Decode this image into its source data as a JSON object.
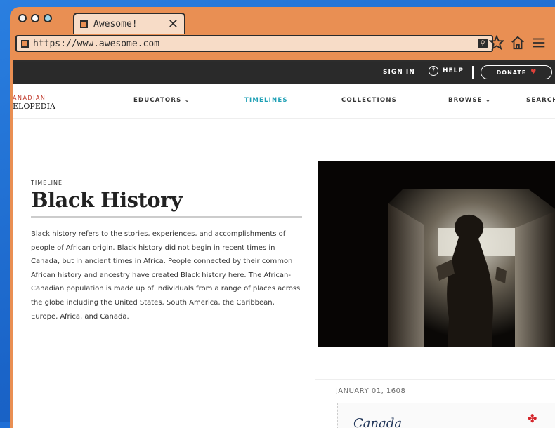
{
  "browser": {
    "tab_title": "Awesome!",
    "tab_close": "✕",
    "url": "https://www.awesome.com"
  },
  "topnav": {
    "sign_in": "SIGN IN",
    "help": "HELP",
    "donate": "DONATE"
  },
  "logo": {
    "line1": "ANADIAN",
    "line2": "ELOPEDIA"
  },
  "mainnav": {
    "items": [
      {
        "label": "EDUCATORS ⌄"
      },
      {
        "label": "TIMELINES"
      },
      {
        "label": "COLLECTIONS"
      },
      {
        "label": "BROWSE ⌄"
      },
      {
        "label": "SEARCH"
      }
    ]
  },
  "hero": {
    "eyebrow": "TIMELINE",
    "title": "Black History",
    "description": "Black history refers to the stories, experiences, and accomplishments of people of African origin. Black history did not begin in recent times in Canada, but in ancient times in Africa. People connected by their common African history and ancestry have created Black history here. The African-Canadian population is made up of individuals from a range of places across the globe including the United States, South America, the Caribbean, Europe, Africa, and Canada."
  },
  "card": {
    "date": "JANUARY 01, 1608",
    "stamp_word": "Canada"
  },
  "colors": {
    "browser_chrome": "#e98f53",
    "tab_fill": "#f7dcc7",
    "topnav_bg": "#2a2a2a",
    "active_nav": "#1fa0b5",
    "accent_red": "#c0392b"
  }
}
